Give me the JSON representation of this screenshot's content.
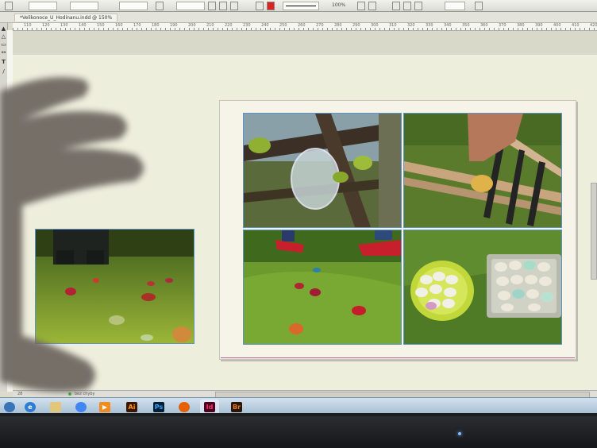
{
  "app": {
    "name": "InDesign",
    "document_tab": "*Velikonoce_U_Hodinanu.indd @ 150%",
    "control_bar": {
      "field1": "",
      "field2": "",
      "zoom_value": "100%"
    }
  },
  "ruler": {
    "ticks": [
      "110",
      "120",
      "130",
      "140",
      "150",
      "160",
      "170",
      "180",
      "190",
      "200",
      "210",
      "220",
      "230",
      "240",
      "250",
      "260",
      "270",
      "280",
      "290",
      "300",
      "310",
      "320",
      "330",
      "340",
      "350",
      "360",
      "370",
      "380",
      "390",
      "400",
      "410",
      "420"
    ]
  },
  "status_bar": {
    "page_number": "28",
    "status_label": "bez chyby"
  },
  "taskbar": {
    "apps": [
      {
        "name": "start-button",
        "label": "",
        "color": "#3a74b7"
      },
      {
        "name": "internet-explorer",
        "label": "e",
        "color": "#2c7dd3"
      },
      {
        "name": "file-explorer",
        "label": "",
        "color": "#e2c77a"
      },
      {
        "name": "chrome",
        "label": "",
        "color": "#4285f4"
      },
      {
        "name": "media-player",
        "label": "▶",
        "color": "#f28a1e"
      },
      {
        "name": "illustrator",
        "label": "Ai",
        "color": "#3c1400",
        "text_color": "#ff9a00"
      },
      {
        "name": "photoshop",
        "label": "Ps",
        "color": "#001e36",
        "text_color": "#31a8ff"
      },
      {
        "name": "firefox",
        "label": "",
        "color": "#e66000"
      },
      {
        "name": "indesign",
        "label": "Id",
        "color": "#49021f",
        "text_color": "#ff3366"
      },
      {
        "name": "bridge",
        "label": "Br",
        "color": "#2b1506",
        "text_color": "#e37a1f"
      }
    ]
  },
  "colors": {
    "frame_guide": "#5f93c8",
    "bleed": "#b65a9a"
  }
}
